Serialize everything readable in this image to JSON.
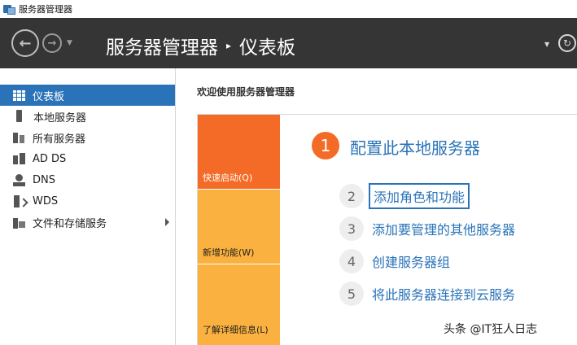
{
  "window": {
    "title": "服务器管理器"
  },
  "header": {
    "breadcrumb_root": "服务器管理器",
    "breadcrumb_separator": "▸",
    "breadcrumb_current": "仪表板"
  },
  "sidebar": {
    "items": [
      {
        "label": "仪表板",
        "icon": "dashboard-icon",
        "active": true
      },
      {
        "label": "本地服务器",
        "icon": "server-icon"
      },
      {
        "label": "所有服务器",
        "icon": "servers-icon"
      },
      {
        "label": "AD DS",
        "icon": "ad-ds-icon"
      },
      {
        "label": "DNS",
        "icon": "dns-icon"
      },
      {
        "label": "WDS",
        "icon": "wds-icon"
      },
      {
        "label": "文件和存储服务",
        "icon": "file-storage-icon",
        "has_submenu": true
      }
    ]
  },
  "main": {
    "welcome": "欢迎使用服务器管理器",
    "tiles": {
      "quick_start": "快速启动(Q)",
      "whats_new": "新增功能(W)",
      "learn_more": "了解详细信息(L)"
    },
    "steps": [
      {
        "num": "1",
        "label": "配置此本地服务器"
      },
      {
        "num": "2",
        "label": "添加角色和功能"
      },
      {
        "num": "3",
        "label": "添加要管理的其他服务器"
      },
      {
        "num": "4",
        "label": "创建服务器组"
      },
      {
        "num": "5",
        "label": "将此服务器连接到云服务"
      }
    ]
  },
  "watermark": "头条 @IT狂人日志",
  "colors": {
    "header_bg": "#353535",
    "accent_blue": "#2a73b8",
    "orange": "#f36b26",
    "amber": "#fbb13f"
  }
}
